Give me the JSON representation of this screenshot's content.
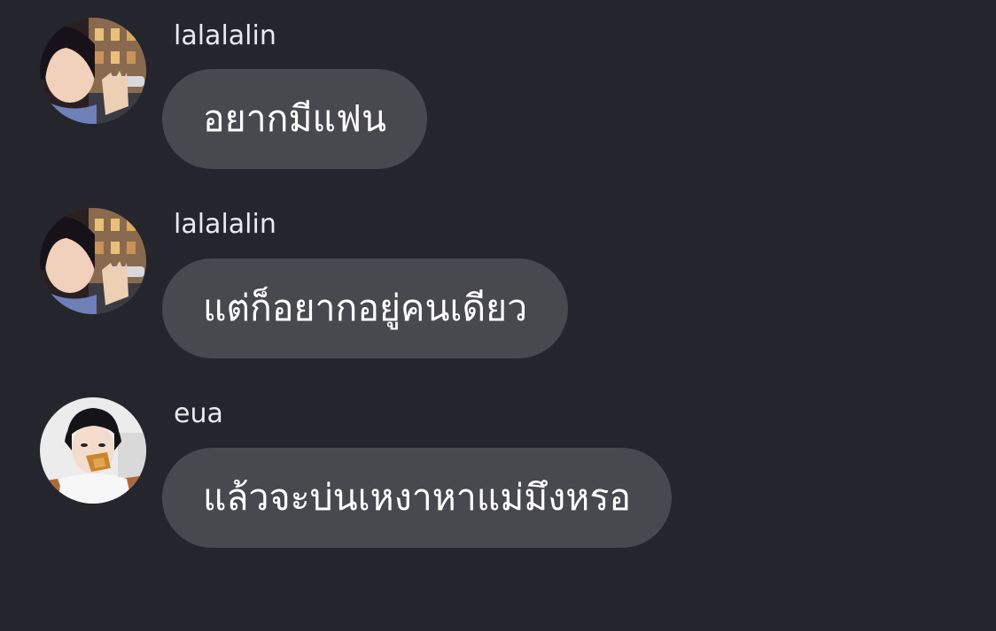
{
  "messages": [
    {
      "username": "lalalalin",
      "text": "อยากมีแฟน",
      "avatar_icon": "user-avatar-lalalalin"
    },
    {
      "username": "lalalalin",
      "text": "แต่ก็อยากอยู่คนเดียว",
      "avatar_icon": "user-avatar-lalalalin"
    },
    {
      "username": "eua",
      "text": "แล้วจะบ่นเหงาหาแม่มึงหรอ",
      "avatar_icon": "user-avatar-eua"
    }
  ],
  "colors": {
    "background": "#25252d",
    "bubble": "#48484f",
    "username": "#e9e9ee",
    "message_text": "#ffffff"
  }
}
